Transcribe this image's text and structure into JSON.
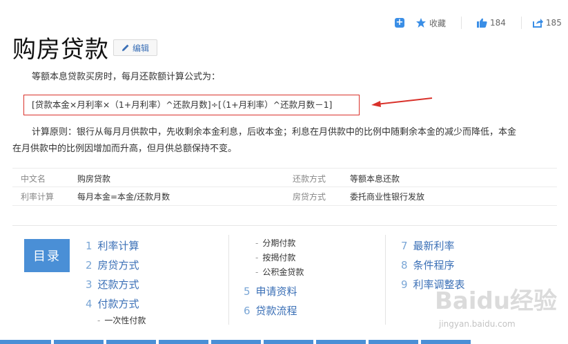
{
  "actions": {
    "favorite_label": "收藏",
    "like_count": "184",
    "share_count": "185"
  },
  "header": {
    "title": "购房贷款",
    "edit_label": "编辑"
  },
  "content": {
    "intro": "等额本息贷款买房时，每月还款额计算公式为：",
    "formula": "[贷款本金×月利率×（1+月利率）^还款月数]÷[（1+月利率）^还款月数－1]",
    "principle_line1": "计算原则：银行从每月月供款中，先收剩余本金利息，后收本金；利息在月供款中的比例中随剩余本金的减少而降低，本金",
    "principle_line2": "在月供款中的比例因增加而升高，但月供总额保持不变。"
  },
  "info": [
    {
      "label1": "中文名",
      "value1": "购房贷款",
      "label2": "还款方式",
      "value2": "等额本息还款"
    },
    {
      "label1": "利率计算",
      "value1": "每月本金=本金/还款月数",
      "label2": "房贷方式",
      "value2": "委托商业性银行发放"
    }
  ],
  "toc": {
    "badge": "目录",
    "col1": [
      {
        "num": "1",
        "label": "利率计算"
      },
      {
        "num": "2",
        "label": "房贷方式"
      },
      {
        "num": "3",
        "label": "还款方式"
      },
      {
        "num": "4",
        "label": "付款方式"
      }
    ],
    "col1_sub": [
      "一次性付款"
    ],
    "col2_sub": [
      "分期付款",
      "按揭付款",
      "公积金贷款"
    ],
    "col2": [
      {
        "num": "5",
        "label": "申请资料"
      },
      {
        "num": "6",
        "label": "贷款流程"
      }
    ],
    "col3": [
      {
        "num": "7",
        "label": "最新利率"
      },
      {
        "num": "8",
        "label": "条件程序"
      },
      {
        "num": "9",
        "label": "利率调整表"
      }
    ]
  },
  "watermark": {
    "logo": "Baidu经验",
    "url": "jingyan.baidu.com"
  },
  "colors": {
    "accent": "#4a8fd6",
    "link": "#3a6fb6",
    "highlight_border": "#d9312a"
  }
}
